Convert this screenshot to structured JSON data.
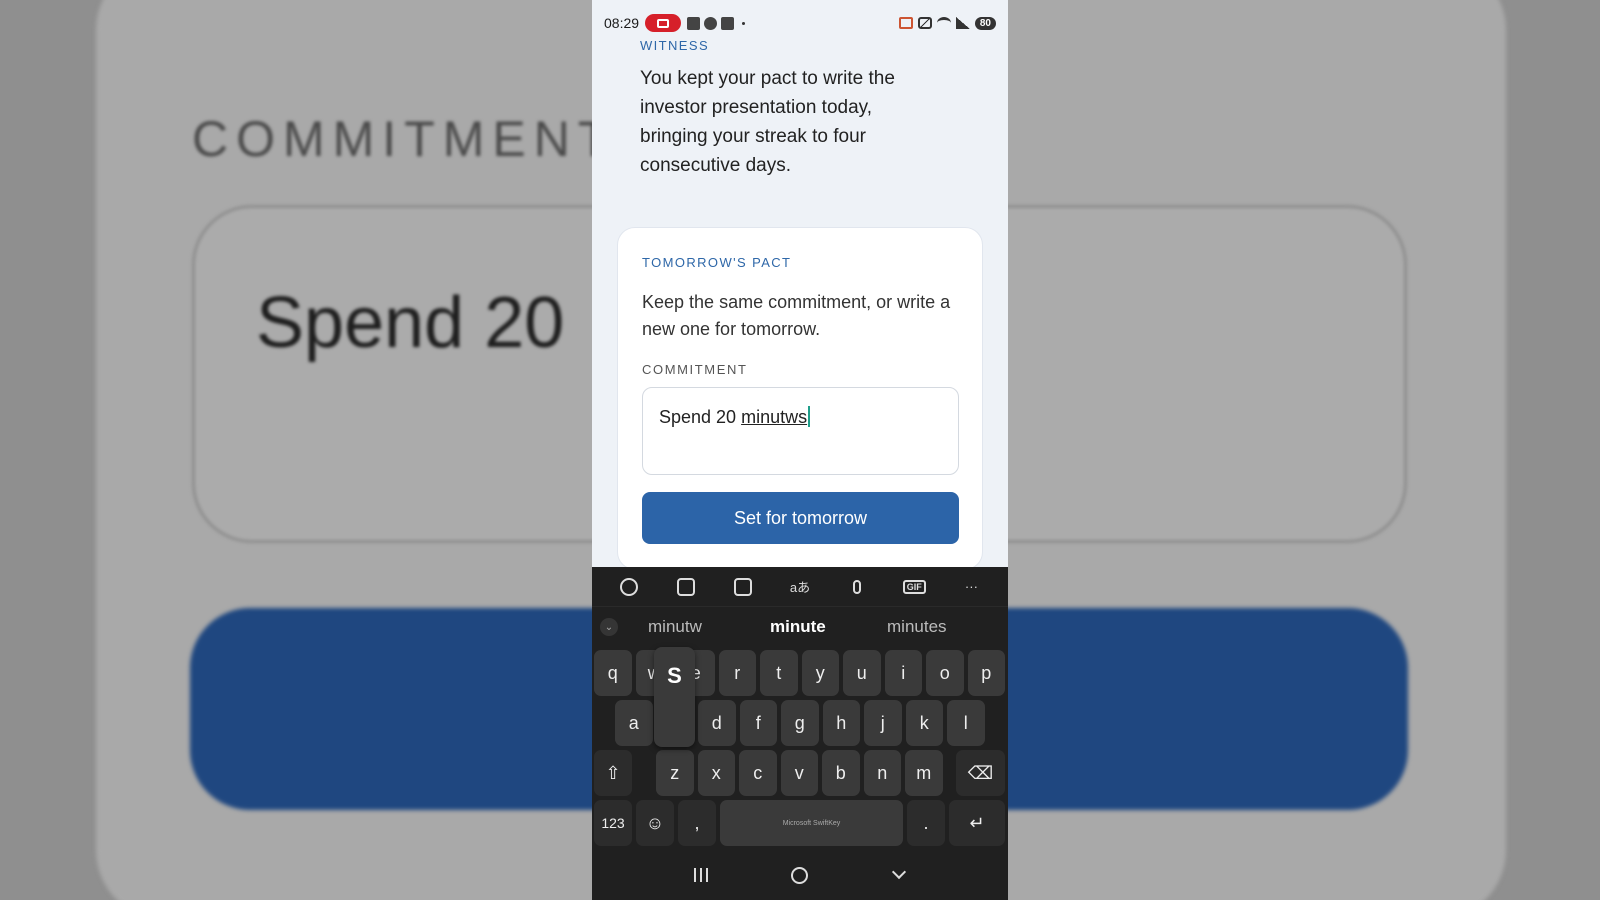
{
  "background": {
    "input_text": "Spend 20"
  },
  "status_bar": {
    "time": "08:29",
    "battery": "80"
  },
  "witness": {
    "label": "WITNESS",
    "message": "You kept your pact to write the investor presentation today, bringing your streak to four consecutive days."
  },
  "pact_card": {
    "label": "TOMORROW'S PACT",
    "description": "Keep the same commitment, or write a new one for tomorrow.",
    "field_label": "COMMITMENT",
    "input_prefix": "Spend 20 ",
    "input_typed": "minutws",
    "button_label": "Set for tomorrow"
  },
  "keyboard": {
    "suggestions": [
      "minutw",
      "minute",
      "minutes"
    ],
    "popup_key": "S",
    "row1": [
      "q",
      "w",
      "e",
      "r",
      "t",
      "y",
      "u",
      "i",
      "o",
      "p"
    ],
    "row2": [
      "a",
      "s",
      "d",
      "f",
      "g",
      "h",
      "j",
      "k",
      "l"
    ],
    "row3": [
      "z",
      "x",
      "c",
      "v",
      "b",
      "n",
      "m"
    ],
    "numbers_key": "123",
    "comma_key": ",",
    "period_key": ".",
    "space_label": "Microsoft SwiftKey"
  },
  "colors": {
    "accent": "#2c64a8",
    "label_blue": "#2e67a8",
    "keyboard_bg": "#202020"
  }
}
